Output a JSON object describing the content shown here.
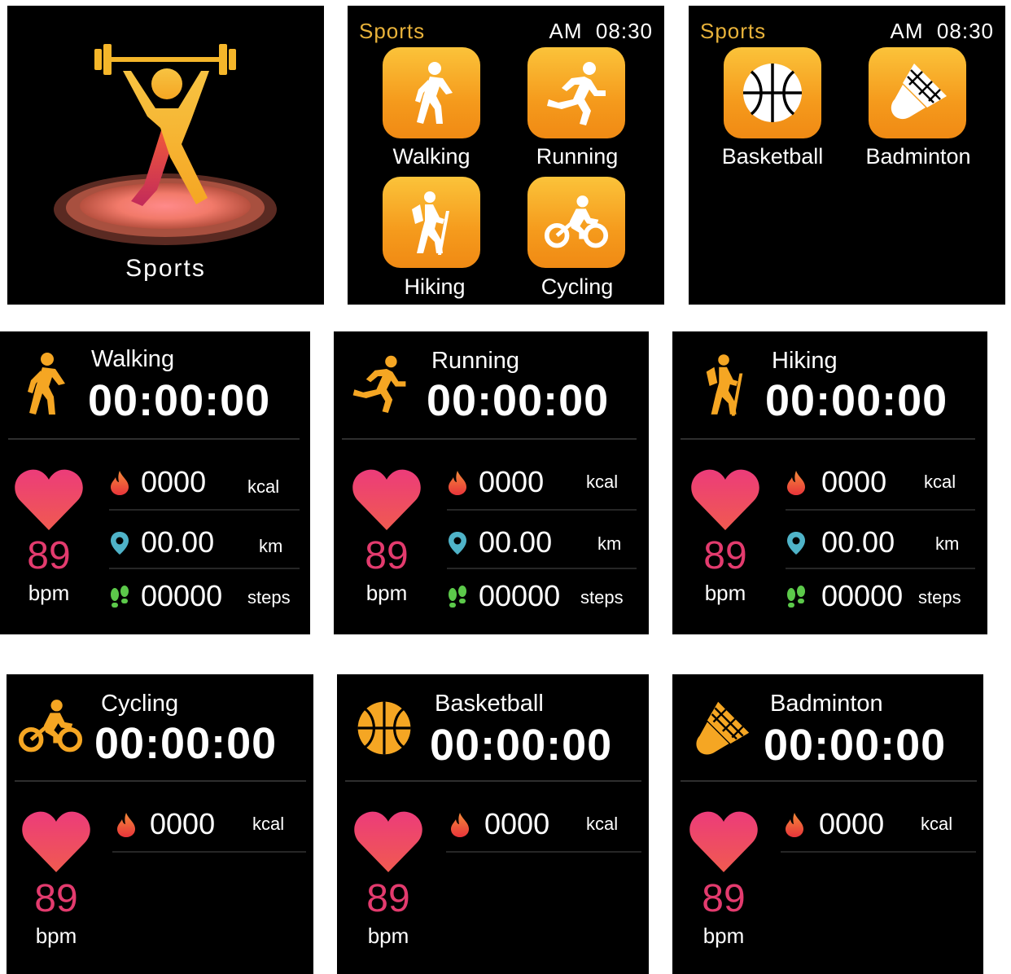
{
  "overview": {
    "label": "Sports"
  },
  "menu_1": {
    "title": "Sports",
    "clock": "AM  08:30",
    "items": [
      {
        "label": "Walking",
        "icon": "walking-icon"
      },
      {
        "label": "Running",
        "icon": "running-icon"
      },
      {
        "label": "Hiking",
        "icon": "hiking-icon"
      },
      {
        "label": "Cycling",
        "icon": "cycling-icon"
      }
    ]
  },
  "menu_2": {
    "title": "Sports",
    "clock": "AM  08:30",
    "items": [
      {
        "label": "Basketball",
        "icon": "basketball-icon"
      },
      {
        "label": "Badminton",
        "icon": "badminton-icon"
      }
    ]
  },
  "activities": [
    {
      "name": "Walking",
      "timer": "00:00:00",
      "icon": "walking-icon",
      "heart_rate": "89",
      "heart_unit": "bpm",
      "kcal": "0000",
      "kcal_unit": "kcal",
      "distance": "00.00",
      "distance_unit": "km",
      "steps": "00000",
      "steps_unit": "steps"
    },
    {
      "name": "Running",
      "timer": "00:00:00",
      "icon": "running-icon",
      "heart_rate": "89",
      "heart_unit": "bpm",
      "kcal": "0000",
      "kcal_unit": "kcal",
      "distance": "00.00",
      "distance_unit": "km",
      "steps": "00000",
      "steps_unit": "steps"
    },
    {
      "name": "Hiking",
      "timer": "00:00:00",
      "icon": "hiking-icon",
      "heart_rate": "89",
      "heart_unit": "bpm",
      "kcal": "0000",
      "kcal_unit": "kcal",
      "distance": "00.00",
      "distance_unit": "km",
      "steps": "00000",
      "steps_unit": "steps"
    },
    {
      "name": "Cycling",
      "timer": "00:00:00",
      "icon": "cycling-icon",
      "heart_rate": "89",
      "heart_unit": "bpm",
      "kcal": "0000",
      "kcal_unit": "kcal"
    },
    {
      "name": "Basketball",
      "timer": "00:00:00",
      "icon": "basketball-icon",
      "heart_rate": "89",
      "heart_unit": "bpm",
      "kcal": "0000",
      "kcal_unit": "kcal"
    },
    {
      "name": "Badminton",
      "timer": "00:00:00",
      "icon": "badminton-icon",
      "heart_rate": "89",
      "heart_unit": "bpm",
      "kcal": "0000",
      "kcal_unit": "kcal"
    }
  ],
  "colors": {
    "accent": "#f5a623",
    "title": "#e8b23a",
    "heart": "#e33b6e",
    "location": "#4fb3c8",
    "steps": "#5cc94a",
    "flame": "#f05a3a"
  }
}
